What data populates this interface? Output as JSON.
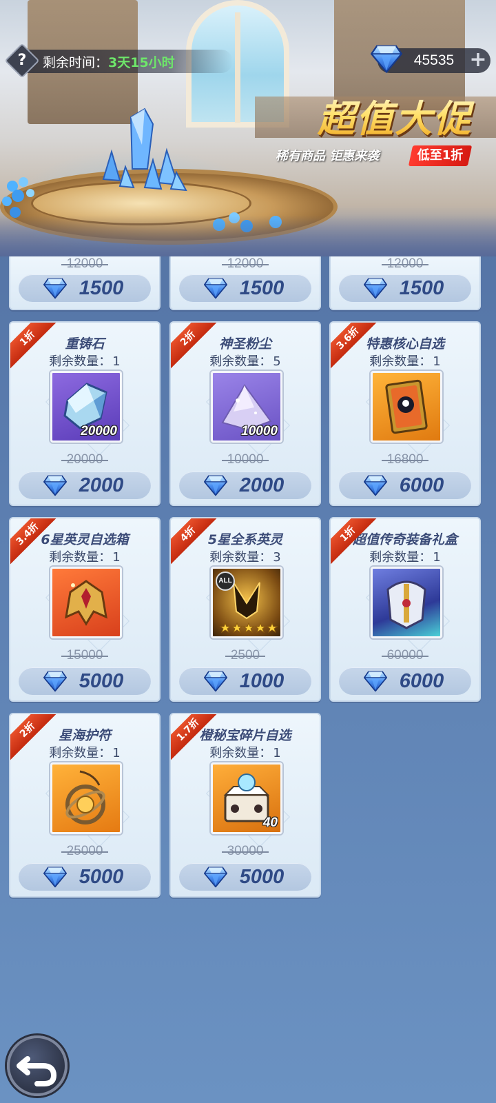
{
  "header": {
    "help_icon": "question-icon",
    "timer_label": "剩余时间：",
    "timer_value": "3天15小时",
    "currency_amount": "45535",
    "add_label": "+"
  },
  "banner": {
    "title": "超值大促",
    "subtitle": "稀有商品 钜惠来袭",
    "tag": "低至1折"
  },
  "partial_row": [
    {
      "original_price": "12000",
      "price": "1500"
    },
    {
      "original_price": "12000",
      "price": "1500"
    },
    {
      "original_price": "12000",
      "price": "1500"
    }
  ],
  "items": [
    {
      "discount": "1折",
      "name": "重铸石",
      "remain_label": "剩余数量：",
      "remain": "1",
      "qty": "20000",
      "original_price": "20000",
      "price": "2000",
      "icon": "reforge-stone-icon"
    },
    {
      "discount": "2折",
      "name": "神圣粉尘",
      "remain_label": "剩余数量：",
      "remain": "5",
      "qty": "10000",
      "original_price": "10000",
      "price": "2000",
      "icon": "holy-dust-icon"
    },
    {
      "discount": "3.6折",
      "name": "特惠核心自选",
      "remain_label": "剩余数量：",
      "remain": "1",
      "qty": "",
      "original_price": "16800",
      "price": "6000",
      "icon": "core-card-icon"
    },
    {
      "discount": "3.4折",
      "name": "6星英灵自选箱",
      "remain_label": "剩余数量：",
      "remain": "1",
      "qty": "",
      "original_price": "15000",
      "price": "5000",
      "icon": "hero-helmet-icon"
    },
    {
      "discount": "4折",
      "name": "5星全系英灵",
      "remain_label": "剩余数量：",
      "remain": "3",
      "qty": "",
      "original_price": "2500",
      "price": "1000",
      "icon": "all-hero-icon",
      "badge": "ALL"
    },
    {
      "discount": "1折",
      "name": "超值传奇装备礼盒",
      "remain_label": "剩余数量：",
      "remain": "1",
      "qty": "",
      "original_price": "60000",
      "price": "6000",
      "icon": "legend-armor-icon"
    },
    {
      "discount": "2折",
      "name": "星海护符",
      "remain_label": "剩余数量：",
      "remain": "1",
      "qty": "",
      "original_price": "25000",
      "price": "5000",
      "icon": "amulet-icon"
    },
    {
      "discount": "1.7折",
      "name": "橙秘宝碎片自选",
      "remain_label": "剩余数量：",
      "remain": "1",
      "qty": "40",
      "original_price": "30000",
      "price": "5000",
      "icon": "treasure-shard-icon"
    }
  ],
  "colors": {
    "price_text": "#2f4a86",
    "ribbon": "#d9381b",
    "timer_value": "#6ee66a"
  }
}
